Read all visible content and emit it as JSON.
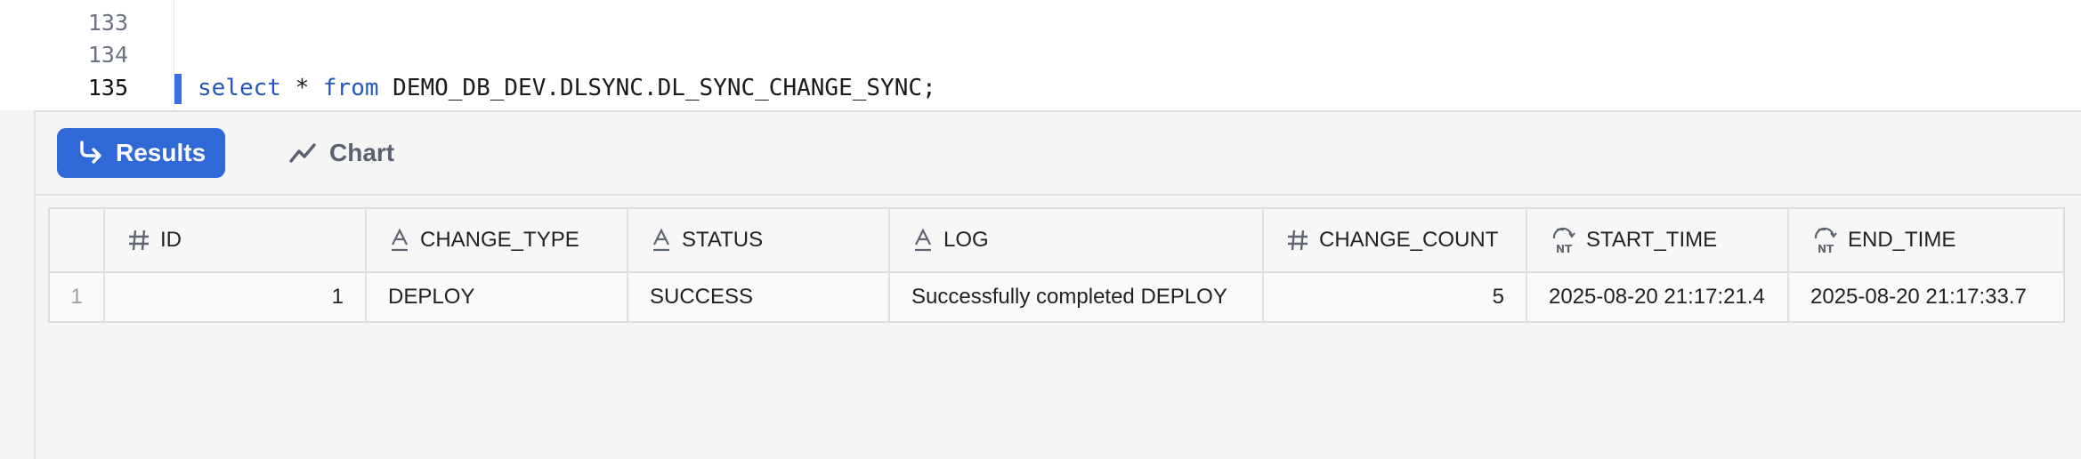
{
  "editor": {
    "lines": [
      {
        "number": "133",
        "code": ""
      },
      {
        "number": "134",
        "code": ""
      },
      {
        "number": "135",
        "kw1": "select",
        "mid": " * ",
        "kw2": "from",
        "rest": " DEMO_DB_DEV.DLSYNC.DL_SYNC_CHANGE_SYNC;"
      }
    ]
  },
  "toolbar": {
    "results_label": "Results",
    "chart_label": "Chart"
  },
  "table": {
    "columns": [
      {
        "label": "ID",
        "type_icon": "number-icon"
      },
      {
        "label": "CHANGE_TYPE",
        "type_icon": "text-icon"
      },
      {
        "label": "STATUS",
        "type_icon": "text-icon"
      },
      {
        "label": "LOG",
        "type_icon": "text-icon"
      },
      {
        "label": "CHANGE_COUNT",
        "type_icon": "number-icon"
      },
      {
        "label": "START_TIME",
        "type_icon": "timestamp-ntz-icon"
      },
      {
        "label": "END_TIME",
        "type_icon": "timestamp-ntz-icon"
      }
    ],
    "rows": [
      {
        "row_number": "1",
        "id": "1",
        "change_type": "DEPLOY",
        "status": "SUCCESS",
        "log": "Successfully completed DEPLOY",
        "change_count": "5",
        "start_time": "2025-08-20 21:17:21.4",
        "end_time": "2025-08-20 21:17:33.7"
      }
    ]
  },
  "colors": {
    "accent": "#3168d8",
    "keyword": "#2457c5",
    "line_marker": "#3d6be0"
  }
}
